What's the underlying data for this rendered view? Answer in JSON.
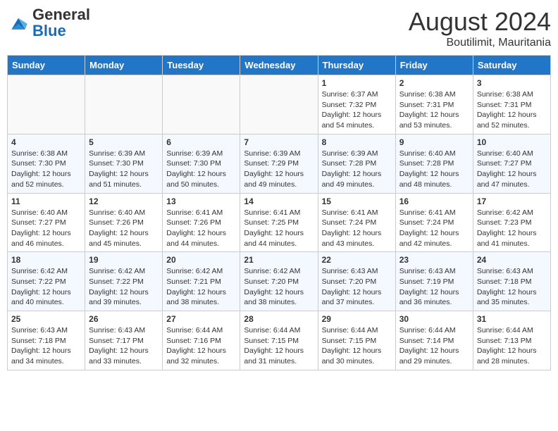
{
  "header": {
    "logo_general": "General",
    "logo_blue": "Blue",
    "month_year": "August 2024",
    "location": "Boutilimit, Mauritania"
  },
  "days_of_week": [
    "Sunday",
    "Monday",
    "Tuesday",
    "Wednesday",
    "Thursday",
    "Friday",
    "Saturday"
  ],
  "weeks": [
    [
      {
        "day": "",
        "empty": true
      },
      {
        "day": "",
        "empty": true
      },
      {
        "day": "",
        "empty": true
      },
      {
        "day": "",
        "empty": true
      },
      {
        "day": "1",
        "sunrise": "6:37 AM",
        "sunset": "7:32 PM",
        "daylight": "12 hours and 54 minutes."
      },
      {
        "day": "2",
        "sunrise": "6:38 AM",
        "sunset": "7:31 PM",
        "daylight": "12 hours and 53 minutes."
      },
      {
        "day": "3",
        "sunrise": "6:38 AM",
        "sunset": "7:31 PM",
        "daylight": "12 hours and 52 minutes."
      }
    ],
    [
      {
        "day": "4",
        "sunrise": "6:38 AM",
        "sunset": "7:30 PM",
        "daylight": "12 hours and 52 minutes."
      },
      {
        "day": "5",
        "sunrise": "6:39 AM",
        "sunset": "7:30 PM",
        "daylight": "12 hours and 51 minutes."
      },
      {
        "day": "6",
        "sunrise": "6:39 AM",
        "sunset": "7:30 PM",
        "daylight": "12 hours and 50 minutes."
      },
      {
        "day": "7",
        "sunrise": "6:39 AM",
        "sunset": "7:29 PM",
        "daylight": "12 hours and 49 minutes."
      },
      {
        "day": "8",
        "sunrise": "6:39 AM",
        "sunset": "7:28 PM",
        "daylight": "12 hours and 49 minutes."
      },
      {
        "day": "9",
        "sunrise": "6:40 AM",
        "sunset": "7:28 PM",
        "daylight": "12 hours and 48 minutes."
      },
      {
        "day": "10",
        "sunrise": "6:40 AM",
        "sunset": "7:27 PM",
        "daylight": "12 hours and 47 minutes."
      }
    ],
    [
      {
        "day": "11",
        "sunrise": "6:40 AM",
        "sunset": "7:27 PM",
        "daylight": "12 hours and 46 minutes."
      },
      {
        "day": "12",
        "sunrise": "6:40 AM",
        "sunset": "7:26 PM",
        "daylight": "12 hours and 45 minutes."
      },
      {
        "day": "13",
        "sunrise": "6:41 AM",
        "sunset": "7:26 PM",
        "daylight": "12 hours and 44 minutes."
      },
      {
        "day": "14",
        "sunrise": "6:41 AM",
        "sunset": "7:25 PM",
        "daylight": "12 hours and 44 minutes."
      },
      {
        "day": "15",
        "sunrise": "6:41 AM",
        "sunset": "7:24 PM",
        "daylight": "12 hours and 43 minutes."
      },
      {
        "day": "16",
        "sunrise": "6:41 AM",
        "sunset": "7:24 PM",
        "daylight": "12 hours and 42 minutes."
      },
      {
        "day": "17",
        "sunrise": "6:42 AM",
        "sunset": "7:23 PM",
        "daylight": "12 hours and 41 minutes."
      }
    ],
    [
      {
        "day": "18",
        "sunrise": "6:42 AM",
        "sunset": "7:22 PM",
        "daylight": "12 hours and 40 minutes."
      },
      {
        "day": "19",
        "sunrise": "6:42 AM",
        "sunset": "7:22 PM",
        "daylight": "12 hours and 39 minutes."
      },
      {
        "day": "20",
        "sunrise": "6:42 AM",
        "sunset": "7:21 PM",
        "daylight": "12 hours and 38 minutes."
      },
      {
        "day": "21",
        "sunrise": "6:42 AM",
        "sunset": "7:20 PM",
        "daylight": "12 hours and 38 minutes."
      },
      {
        "day": "22",
        "sunrise": "6:43 AM",
        "sunset": "7:20 PM",
        "daylight": "12 hours and 37 minutes."
      },
      {
        "day": "23",
        "sunrise": "6:43 AM",
        "sunset": "7:19 PM",
        "daylight": "12 hours and 36 minutes."
      },
      {
        "day": "24",
        "sunrise": "6:43 AM",
        "sunset": "7:18 PM",
        "daylight": "12 hours and 35 minutes."
      }
    ],
    [
      {
        "day": "25",
        "sunrise": "6:43 AM",
        "sunset": "7:18 PM",
        "daylight": "12 hours and 34 minutes."
      },
      {
        "day": "26",
        "sunrise": "6:43 AM",
        "sunset": "7:17 PM",
        "daylight": "12 hours and 33 minutes."
      },
      {
        "day": "27",
        "sunrise": "6:44 AM",
        "sunset": "7:16 PM",
        "daylight": "12 hours and 32 minutes."
      },
      {
        "day": "28",
        "sunrise": "6:44 AM",
        "sunset": "7:15 PM",
        "daylight": "12 hours and 31 minutes."
      },
      {
        "day": "29",
        "sunrise": "6:44 AM",
        "sunset": "7:15 PM",
        "daylight": "12 hours and 30 minutes."
      },
      {
        "day": "30",
        "sunrise": "6:44 AM",
        "sunset": "7:14 PM",
        "daylight": "12 hours and 29 minutes."
      },
      {
        "day": "31",
        "sunrise": "6:44 AM",
        "sunset": "7:13 PM",
        "daylight": "12 hours and 28 minutes."
      }
    ]
  ]
}
